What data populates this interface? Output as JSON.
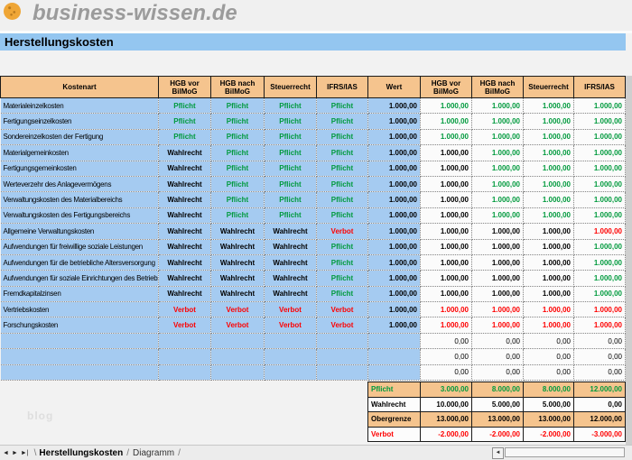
{
  "logo": {
    "text": "business-wissen.de",
    "icon": "orange-dot-logo"
  },
  "title": "Herstellungskosten",
  "colors": {
    "pflicht_green": "#009a3d",
    "verbot_red": "#fe0000",
    "header_peach": "#f5c48e",
    "row_blue": "#a5cbf1",
    "title_blue": "#94c6f0"
  },
  "icons": {
    "tab_nav_left": "◄",
    "tab_nav_right": "►",
    "tab_nav_last": "►|",
    "scroll_left": "◄"
  },
  "table": {
    "headers": [
      "Kostenart",
      "HGB vor BilMoG",
      "HGB nach BilMoG",
      "Steuerrecht",
      "IFRS/IAS",
      "Wert",
      "HGB vor BilMoG",
      "HGB nach BilMoG",
      "Steuerrecht",
      "IFRS/IAS"
    ],
    "rule_labels": {
      "pflicht": "Pflicht",
      "wahlrecht": "Wahlrecht",
      "verbot": "Verbot"
    },
    "zero_value": "0,00",
    "empty_row_count": 3,
    "rows": [
      {
        "kostenart": "Materialeinzelkosten",
        "rules": [
          "pflicht",
          "pflicht",
          "pflicht",
          "pflicht"
        ],
        "wert": "1.000,00",
        "values": [
          "1.000,00",
          "1.000,00",
          "1.000,00",
          "1.000,00"
        ]
      },
      {
        "kostenart": "Fertigungseinzelkosten",
        "rules": [
          "pflicht",
          "pflicht",
          "pflicht",
          "pflicht"
        ],
        "wert": "1.000,00",
        "values": [
          "1.000,00",
          "1.000,00",
          "1.000,00",
          "1.000,00"
        ]
      },
      {
        "kostenart": "Sondereinzelkosten der Fertigung",
        "rules": [
          "pflicht",
          "pflicht",
          "pflicht",
          "pflicht"
        ],
        "wert": "1.000,00",
        "values": [
          "1.000,00",
          "1.000,00",
          "1.000,00",
          "1.000,00"
        ]
      },
      {
        "kostenart": "Materialgemeinkosten",
        "rules": [
          "wahlrecht",
          "pflicht",
          "pflicht",
          "pflicht"
        ],
        "wert": "1.000,00",
        "values": [
          "1.000,00",
          "1.000,00",
          "1.000,00",
          "1.000,00"
        ]
      },
      {
        "kostenart": "Fertigungsgemeinkosten",
        "rules": [
          "wahlrecht",
          "pflicht",
          "pflicht",
          "pflicht"
        ],
        "wert": "1.000,00",
        "values": [
          "1.000,00",
          "1.000,00",
          "1.000,00",
          "1.000,00"
        ]
      },
      {
        "kostenart": "Werteverzehr des Anlagevermögens",
        "rules": [
          "wahlrecht",
          "pflicht",
          "pflicht",
          "pflicht"
        ],
        "wert": "1.000,00",
        "values": [
          "1.000,00",
          "1.000,00",
          "1.000,00",
          "1.000,00"
        ]
      },
      {
        "kostenart": "Verwaltungskosten des Materialbereichs",
        "rules": [
          "wahlrecht",
          "pflicht",
          "pflicht",
          "pflicht"
        ],
        "wert": "1.000,00",
        "values": [
          "1.000,00",
          "1.000,00",
          "1.000,00",
          "1.000,00"
        ]
      },
      {
        "kostenart": "Verwaltungskosten des Fertigungsbereichs",
        "rules": [
          "wahlrecht",
          "pflicht",
          "pflicht",
          "pflicht"
        ],
        "wert": "1.000,00",
        "values": [
          "1.000,00",
          "1.000,00",
          "1.000,00",
          "1.000,00"
        ]
      },
      {
        "kostenart": "Allgemeine Verwaltungskosten",
        "rules": [
          "wahlrecht",
          "wahlrecht",
          "wahlrecht",
          "verbot"
        ],
        "wert": "1.000,00",
        "values": [
          "1.000,00",
          "1.000,00",
          "1.000,00",
          "1.000,00"
        ]
      },
      {
        "kostenart": "Aufwendungen für freiwillige soziale Leistungen",
        "rules": [
          "wahlrecht",
          "wahlrecht",
          "wahlrecht",
          "pflicht"
        ],
        "wert": "1.000,00",
        "values": [
          "1.000,00",
          "1.000,00",
          "1.000,00",
          "1.000,00"
        ]
      },
      {
        "kostenart": "Aufwendungen für die betriebliche Altersversorgung",
        "rules": [
          "wahlrecht",
          "wahlrecht",
          "wahlrecht",
          "pflicht"
        ],
        "wert": "1.000,00",
        "values": [
          "1.000,00",
          "1.000,00",
          "1.000,00",
          "1.000,00"
        ]
      },
      {
        "kostenart": "Aufwendungen für soziale Einrichtungen des Betriebs",
        "rules": [
          "wahlrecht",
          "wahlrecht",
          "wahlrecht",
          "pflicht"
        ],
        "wert": "1.000,00",
        "values": [
          "1.000,00",
          "1.000,00",
          "1.000,00",
          "1.000,00"
        ]
      },
      {
        "kostenart": "Fremdkapitalzinsen",
        "rules": [
          "wahlrecht",
          "wahlrecht",
          "wahlrecht",
          "pflicht"
        ],
        "wert": "1.000,00",
        "values": [
          "1.000,00",
          "1.000,00",
          "1.000,00",
          "1.000,00"
        ]
      },
      {
        "kostenart": "Vertriebskosten",
        "rules": [
          "verbot",
          "verbot",
          "verbot",
          "verbot"
        ],
        "wert": "1.000,00",
        "values": [
          "1.000,00",
          "1.000,00",
          "1.000,00",
          "1.000,00"
        ]
      },
      {
        "kostenart": "Forschungskosten",
        "rules": [
          "verbot",
          "verbot",
          "verbot",
          "verbot"
        ],
        "wert": "1.000,00",
        "values": [
          "1.000,00",
          "1.000,00",
          "1.000,00",
          "1.000,00"
        ]
      }
    ]
  },
  "summary": {
    "rows": [
      {
        "label": "Pflicht",
        "color": "pflicht",
        "bg": "peach",
        "values": [
          "3.000,00",
          "8.000,00",
          "8.000,00",
          "12.000,00"
        ]
      },
      {
        "label": "Wahlrecht",
        "color": "wahlrecht",
        "bg": "white",
        "values": [
          "10.000,00",
          "5.000,00",
          "5.000,00",
          "0,00"
        ]
      },
      {
        "label": "Obergrenze",
        "color": "wahlrecht",
        "bg": "peach",
        "values": [
          "13.000,00",
          "13.000,00",
          "13.000,00",
          "12.000,00"
        ]
      },
      {
        "label": "Verbot",
        "color": "verbot",
        "bg": "white",
        "values": [
          "-2.000,00",
          "-2.000,00",
          "-2.000,00",
          "-3.000,00"
        ]
      }
    ]
  },
  "sheet_tabs": {
    "active": "Herstellungskosten",
    "other": "Diagramm"
  },
  "watermark": "blog"
}
